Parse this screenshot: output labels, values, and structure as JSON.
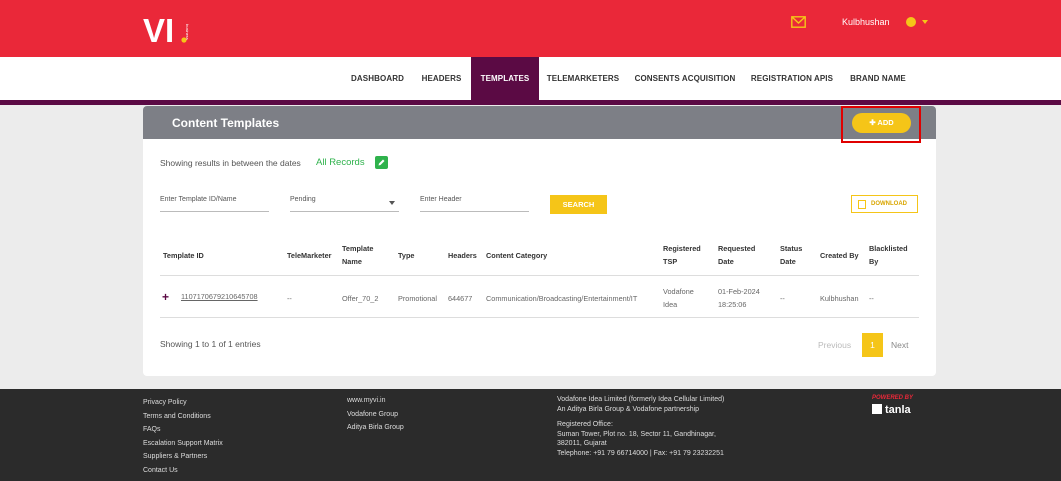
{
  "brand": {
    "logo_text": "VI",
    "logo_sub": "business",
    "primary_color": "#ea2839",
    "accent_color": "#f5c518",
    "nav_active_color": "#5b0a44"
  },
  "header": {
    "username": "Kulbhushan"
  },
  "nav": {
    "items": [
      {
        "label": "DASHBOARD"
      },
      {
        "label": "HEADERS"
      },
      {
        "label": "TEMPLATES",
        "active": true
      },
      {
        "label": "TELEMARKETERS"
      },
      {
        "label": "CONSENTS ACQUISITION"
      },
      {
        "label": "REGISTRATION APIS"
      },
      {
        "label": "BRAND NAME"
      }
    ]
  },
  "card": {
    "title": "Content Templates",
    "add_label": "ADD",
    "dates_text": "Showing results in between the dates",
    "dates_link": "All Records"
  },
  "filters": {
    "template_placeholder": "Enter Template ID/Name",
    "status_value": "Pending",
    "header_placeholder": "Enter Header",
    "search_label": "SEARCH",
    "download_label": "DOWNLOAD"
  },
  "table": {
    "headers": [
      "Template ID",
      "TeleMarketer",
      "Template Name",
      "Type",
      "Headers",
      "Content Category",
      "Registered TSP",
      "Requested Date",
      "Status Date",
      "Created By",
      "Blacklisted By"
    ],
    "rows": [
      [
        "1107170679210645708",
        "--",
        "Offer_70_2",
        "Promotional",
        "644677",
        "Communication/Broadcasting/Entertainment/IT",
        "Vodafone Idea",
        "01-Feb-2024 18:25:06",
        "--",
        "Kulbhushan",
        "--"
      ]
    ]
  },
  "pagination": {
    "info": "Showing 1 to 1 of 1 entries",
    "prev": "Previous",
    "current": "1",
    "next": "Next"
  },
  "footer": {
    "col1": [
      "Privacy Policy",
      "Terms and Conditions",
      "FAQs",
      "Escalation Support Matrix",
      "Suppliers & Partners",
      "Contact Us"
    ],
    "col2": [
      "www.myvi.in",
      "Vodafone Group",
      "Aditya Birla Group"
    ],
    "company": "Vodafone Idea Limited (formerly Idea Cellular Limited) An Aditya Birla Group & Vodafone partnership",
    "office_label": "Registered Office:",
    "office_address": "Suman Tower, Plot no. 18, Sector 11, Gandhinagar, 382011, Gujarat",
    "office_phone": "Telephone: +91 79 66714000 | Fax: +91 79 23232251",
    "powered_by": "POWERED BY",
    "powered_brand": "tanla"
  }
}
